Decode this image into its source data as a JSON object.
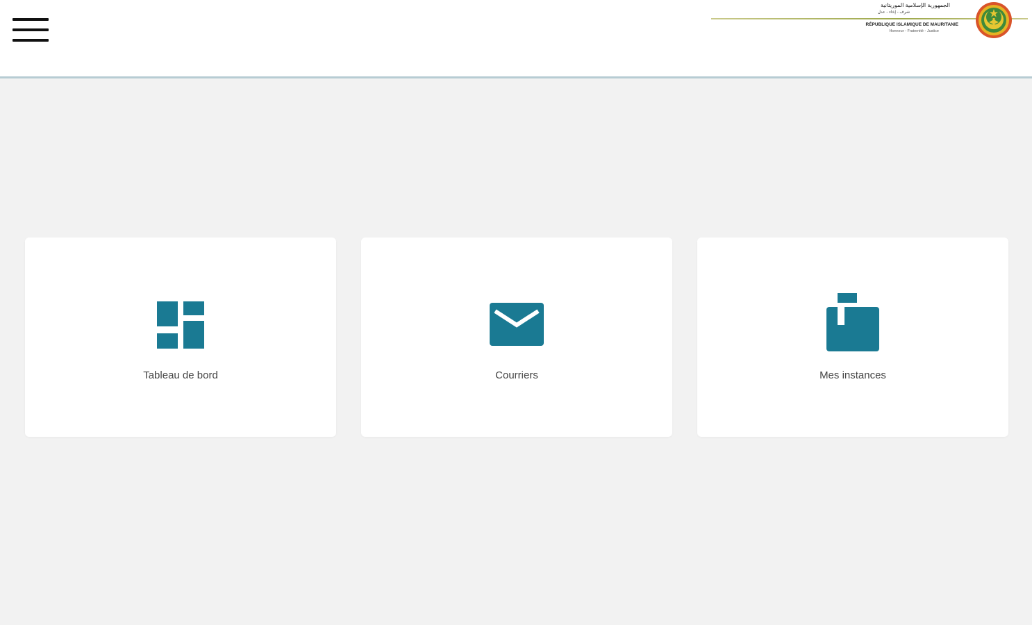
{
  "header": {
    "menu_icon": "hamburger-menu-icon",
    "banner": {
      "arabic_title": "الجمهورية الإسلامية الموريتانية",
      "arabic_motto": "شرف - إخاء - عدل",
      "french_title": "RÉPUBLIQUE ISLAMIQUE DE MAURITANIE",
      "french_motto": "Honneur - Fraternité - Justice",
      "emblem_icon": "national-emblem-seal"
    }
  },
  "cards": [
    {
      "label": "Tableau de bord",
      "icon": "dashboard-icon"
    },
    {
      "label": "Courriers",
      "icon": "mail-envelope-icon"
    },
    {
      "label": "Mes instances",
      "icon": "mailbox-icon"
    }
  ],
  "colors": {
    "accent": "#1a7a93",
    "background": "#f2f2f2",
    "header_border": "#b7ccd3",
    "card": "#ffffff"
  }
}
